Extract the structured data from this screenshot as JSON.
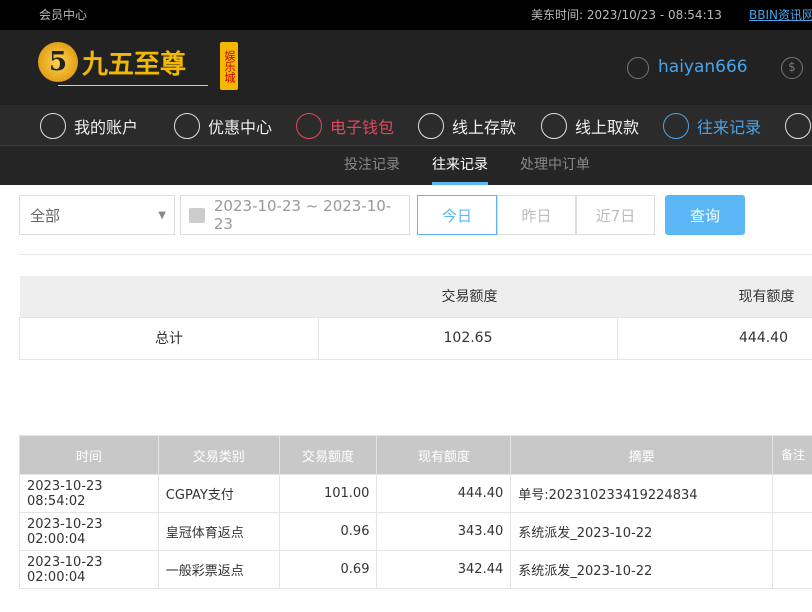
{
  "topbar": {
    "member_center": "会员中心",
    "time_label": "美东时间: 2023/10/23 - 08:54:13",
    "bbin_link": "BBIN资讯网"
  },
  "header": {
    "logo_text": "九五至尊",
    "logo_sub": "娱乐城",
    "username": "haiyan666"
  },
  "nav": [
    {
      "label": "我的账户",
      "icon": "user-icon"
    },
    {
      "label": "优惠中心",
      "icon": "gift-icon"
    },
    {
      "label": "电子钱包",
      "icon": "wallet-icon"
    },
    {
      "label": "线上存款",
      "icon": "deposit-icon"
    },
    {
      "label": "线上取款",
      "icon": "withdraw-icon"
    },
    {
      "label": "往来记录",
      "icon": "records-icon"
    }
  ],
  "subnav": [
    "投注记录",
    "往来记录",
    "处理中订单"
  ],
  "filter": {
    "type": "全部",
    "date_range": "2023-10-23 ~ 2023-10-23",
    "today": "今日",
    "yesterday": "昨日",
    "week": "近7日",
    "query": "查询"
  },
  "summary": {
    "headers": [
      "交易额度",
      "现有额度"
    ],
    "label": "总计",
    "amount": "102.65",
    "balance": "444.40"
  },
  "table": {
    "headers": [
      "时间",
      "交易类别",
      "交易额度",
      "现有额度",
      "摘要",
      "备注"
    ],
    "rows": [
      [
        "2023-10-23 08:54:02",
        "CGPAY支付",
        "101.00",
        "444.40",
        "单号:202310233419224834",
        ""
      ],
      [
        "2023-10-23 02:00:04",
        "皇冠体育返点",
        "0.96",
        "343.40",
        "系统派发_2023-10-22",
        ""
      ],
      [
        "2023-10-23 02:00:04",
        "一般彩票返点",
        "0.69",
        "342.44",
        "系统派发_2023-10-22",
        ""
      ]
    ]
  },
  "colors": {
    "accent": "#5bb6f5",
    "active_red": "#e0475f",
    "active_blue": "#4aa3e8"
  }
}
